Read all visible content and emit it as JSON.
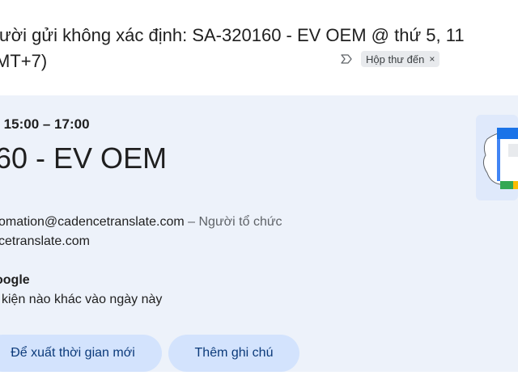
{
  "email": {
    "subject_line1": "ười gửi không xác định: SA-320160 - EV OEM @ thứ 5, 11",
    "subject_line2": "MT+7)",
    "label": "Hộp thư đến",
    "label_remove": "×"
  },
  "event_card": {
    "time": "• 15:00 – 17:00",
    "title": "60 - EV OEM",
    "organizer_email": "omation@cadencetranslate.com",
    "organizer_role": " – Người tổ chức",
    "guest_email": "cetranslate.com",
    "calendar_heading": "oogle",
    "calendar_status": "kiện nào khác vào ngày này",
    "buttons": {
      "propose": "Để xuất thời gian mới",
      "add_note": "Thêm ghi chú"
    }
  },
  "colors": {
    "card_bg": "#edf2fa",
    "button_bg": "#d3e3fd",
    "button_text": "#0b3a7a",
    "chip_bg": "#e8eaed"
  }
}
